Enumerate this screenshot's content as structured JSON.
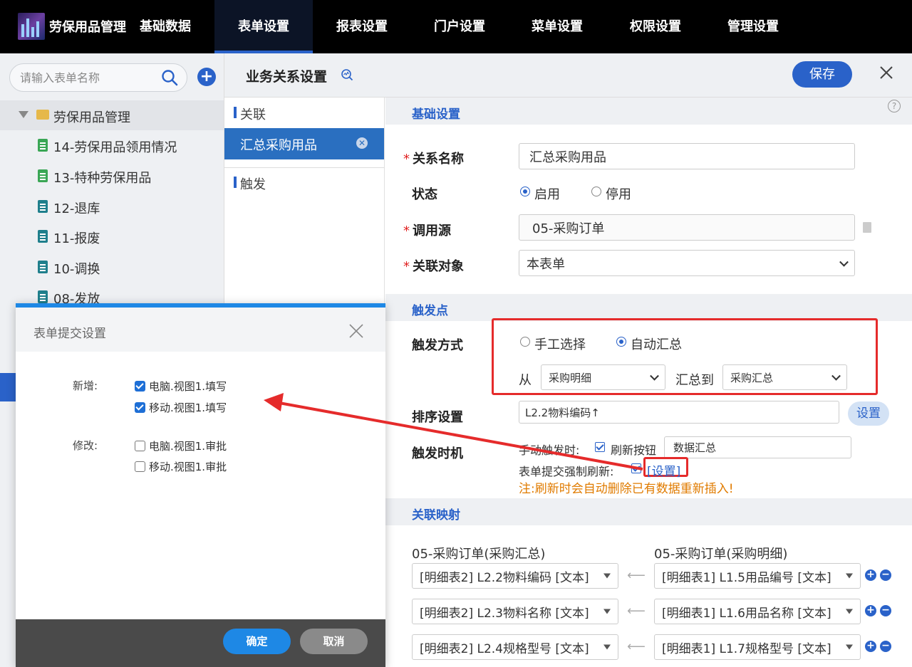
{
  "nav": {
    "brand": "劳保用品管理",
    "items": [
      "基础数据",
      "表单设置",
      "报表设置",
      "门户设置",
      "菜单设置",
      "权限设置",
      "管理设置"
    ],
    "active": 1
  },
  "sidebar": {
    "search_placeholder": "请输入表单名称",
    "root": "劳保用品管理",
    "items": [
      "14-劳保用品领用情况",
      "13-特种劳保用品",
      "12-退库",
      "11-报废",
      "10-调换",
      "08-发放"
    ]
  },
  "header": {
    "title": "业务关系设置",
    "save_label": "保存"
  },
  "midcol": {
    "section_link": "关联",
    "active_item": "汇总采购用品",
    "section_trigger": "触发"
  },
  "form": {
    "basic_title": "基础设置",
    "help": "?",
    "name_label": "关系名称",
    "name_value": "汇总采购用品",
    "status_label": "状态",
    "status_on": "启用",
    "status_off": "停用",
    "source_label": "调用源",
    "source_value": "05-采购订单",
    "target_label": "关联对象",
    "target_value": "本表单",
    "trigger_title": "触发点",
    "trigger_mode_label": "触发方式",
    "mode_manual": "手工选择",
    "mode_auto": "自动汇总",
    "from_label": "从",
    "from_value": "采购明细",
    "to_label": "汇总到",
    "to_value": "采购汇总",
    "sort_label": "排序设置",
    "sort_value": "L2.2物料编码↑",
    "sort_btn": "设置",
    "timing_label": "触发时机",
    "manual_trigger_label": "手动触发时:",
    "refresh_btn_label": "刷新按钮",
    "refresh_btn_value": "数据汇总",
    "submit_refresh_label": "表单提交强制刷新:",
    "submit_refresh_link": "[设置]",
    "warning": "注:刷新时会自动删除已有数据重新插入!",
    "mapping_title": "关联映射",
    "map_left_head": "05-采购订单(采购汇总)",
    "map_right_head": "05-采购订单(采购明细)",
    "mappings": [
      {
        "left": "[明细表2] L2.2物料编码 [文本]",
        "right": "[明细表1] L1.5用品编号 [文本]"
      },
      {
        "left": "[明细表2] L2.3物料名称 [文本]",
        "right": "[明细表1] L1.6用品名称 [文本]"
      },
      {
        "left": "[明细表2] L2.4规格型号 [文本]",
        "right": "[明细表1] L1.7规格型号 [文本]"
      }
    ]
  },
  "modal": {
    "title": "表单提交设置",
    "add_label": "新增:",
    "add_options": [
      "电脑.视图1.填写",
      "移动.视图1.填写"
    ],
    "edit_label": "修改:",
    "edit_options": [
      "电脑.视图1.审批",
      "移动.视图1.审批"
    ],
    "ok": "确定",
    "cancel": "取消"
  }
}
